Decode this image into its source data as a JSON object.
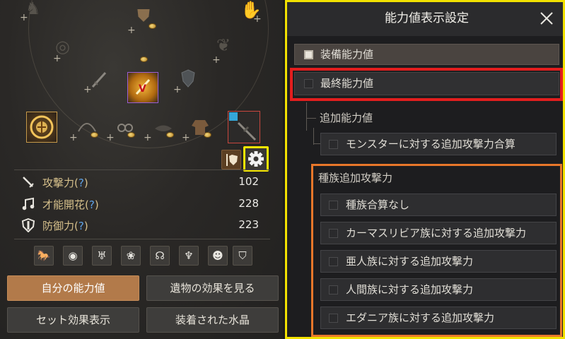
{
  "stats": [
    {
      "label_main": "攻撃力(",
      "q": "?",
      "label_end": ")",
      "value": "102",
      "icon": "sword-icon"
    },
    {
      "label_main": "才能開花(",
      "q": "?",
      "label_end": ")",
      "value": "228",
      "icon": "music-note-icon"
    },
    {
      "label_main": "防御力(",
      "q": "?",
      "label_end": ")",
      "value": "223",
      "icon": "shield-icon"
    }
  ],
  "categories": [
    "rider-icon",
    "masked-face-icon",
    "horned-mask-icon",
    "paw-icon",
    "mermaid-icon",
    "fairy-icon",
    "bust-icon",
    "shield-crest-icon"
  ],
  "buttons": {
    "my_stats": "自分の能力値",
    "relic_effect": "遺物の効果を見る",
    "set_effect": "セット効果表示",
    "crystal": "装着された水晶"
  },
  "panel": {
    "title": "能力値表示設定",
    "equip_stats": "装備能力値",
    "equip_checked": true,
    "final_stats": "最終能力値",
    "final_checked": false,
    "additional_label": "追加能力値",
    "monster_total": "モンスターに対する追加攻撃力合算",
    "race_label": "種族追加攻撃力",
    "race_options": [
      "種族合算なし",
      "カーマスリビア族に対する追加攻撃力",
      "亜人族に対する追加攻撃力",
      "人間族に対する追加攻撃力",
      "エダニア族に対する追加攻撃力"
    ]
  },
  "colors": {
    "highlight_yellow": "#f2e100",
    "highlight_red": "#e31e1e",
    "highlight_orange": "#e8772a",
    "active_button": "#b27a4a",
    "stat_label": "#d6c08b",
    "help_link": "#5fa3e8"
  }
}
